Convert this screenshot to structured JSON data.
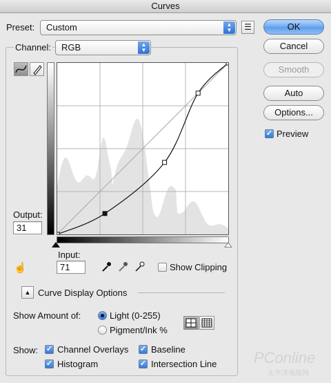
{
  "window": {
    "title": "Curves"
  },
  "preset": {
    "label": "Preset:",
    "value": "Custom"
  },
  "channel": {
    "label": "Channel:",
    "value": "RGB"
  },
  "buttons": {
    "ok": "OK",
    "cancel": "Cancel",
    "smooth": "Smooth",
    "auto": "Auto",
    "options": "Options..."
  },
  "preview": {
    "label": "Preview",
    "checked": true
  },
  "output": {
    "label": "Output:",
    "value": "31"
  },
  "input": {
    "label": "Input:",
    "value": "71"
  },
  "show_clipping": {
    "label": "Show Clipping",
    "checked": false
  },
  "curve_display": {
    "label": "Curve Display Options"
  },
  "show_amount": {
    "label": "Show Amount of:",
    "light": "Light  (0-255)",
    "pigment": "Pigment/Ink %",
    "selected": "light"
  },
  "show": {
    "label": "Show:",
    "channel_overlays": "Channel Overlays",
    "baseline": "Baseline",
    "histogram": "Histogram",
    "intersection_line": "Intersection Line"
  },
  "curve": {
    "points": [
      [
        0,
        0
      ],
      [
        71,
        31
      ],
      [
        160,
        107
      ],
      [
        210,
        210
      ],
      [
        255,
        255
      ]
    ],
    "range": [
      0,
      255
    ]
  },
  "watermark": {
    "text": "PConline",
    "sub": "太平洋电脑网"
  },
  "colors": {
    "accent": "#3b82e6",
    "graph_bg": "#ffffff",
    "histogram": "#e3e3e3"
  }
}
